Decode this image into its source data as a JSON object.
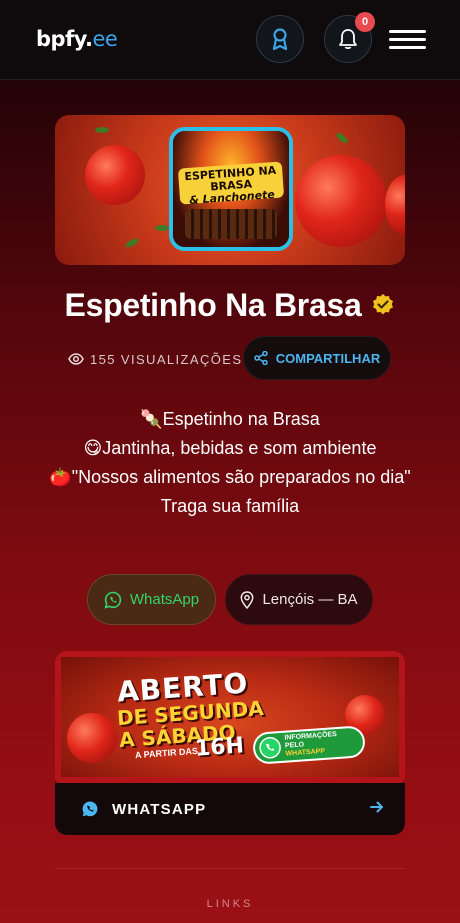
{
  "header": {
    "logo_main": "bpfy",
    "logo_dot": ".",
    "logo_tld": "ee",
    "notification_count": "0",
    "icons": {
      "badge": "ribbon-badge-icon",
      "bell": "bell-icon",
      "menu": "hamburger-menu-icon"
    },
    "colors": {
      "accent": "#3ba4e6",
      "notif": "#e84a4f"
    }
  },
  "hero": {
    "logo_line1": "ESPETINHO NA BRASA",
    "logo_line2": "& Lanchonete"
  },
  "profile": {
    "name": "Espetinho Na Brasa",
    "verified_icon": "verified-check-icon",
    "views": "155 VISUALIZAÇÕES",
    "share_label": "COMPARTILHAR"
  },
  "bio": [
    "🍡Espetinho na Brasa",
    "😋Jantinha, bebidas e som ambiente",
    "🍅\"Nossos alimentos são preparados no dia\"",
    "Traga sua família"
  ],
  "pills": {
    "whatsapp": "WhatsApp",
    "location": "Lençóis — BA"
  },
  "card": {
    "banner": {
      "line1": "ABERTO",
      "line2": "DE SEGUNDA",
      "line3": "A SÁBADO",
      "line4": "A PARTIR DAS",
      "line5": "16H",
      "pill_l1": "INFORMAÇÕES",
      "pill_l2": "PELO",
      "pill_l3": "WHATSAPP"
    },
    "label": "WHATSAPP",
    "colors": {
      "whatsapp": "#4cb6f0"
    }
  },
  "footer": {
    "links_label": "LINKS"
  }
}
